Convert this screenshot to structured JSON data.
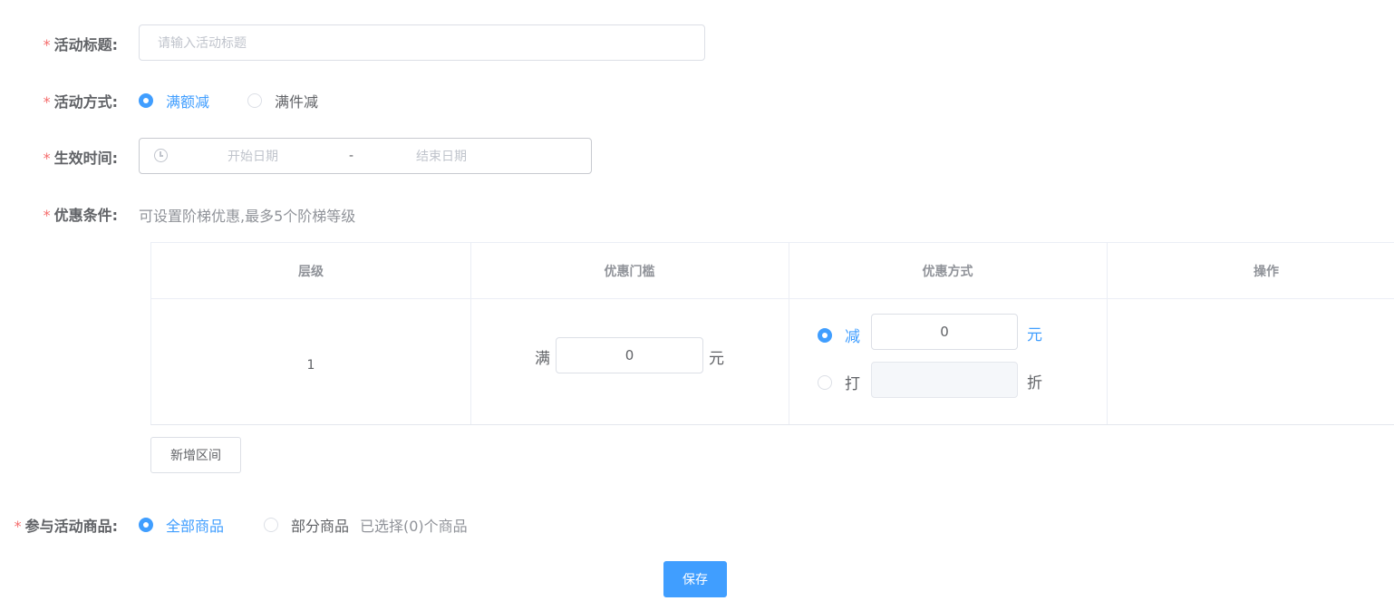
{
  "form": {
    "title": {
      "label": "活动标题:",
      "placeholder": "请输入活动标题"
    },
    "mode": {
      "label": "活动方式:",
      "options": [
        "满额减",
        "满件减"
      ],
      "selected": "满额减"
    },
    "time": {
      "label": "生效时间:",
      "start_placeholder": "开始日期",
      "separator": "-",
      "end_placeholder": "结束日期",
      "icon": "clock-icon"
    },
    "condition": {
      "label": "优惠条件:",
      "hint": "可设置阶梯优惠,最多5个阶梯等级"
    },
    "products": {
      "label": "参与活动商品:",
      "options": [
        "全部商品",
        "部分商品"
      ],
      "selected": "全部商品",
      "selected_count_text": "已选择(0)个商品"
    }
  },
  "table": {
    "headers": [
      "层级",
      "优惠门槛",
      "优惠方式",
      "操作"
    ],
    "rows": [
      {
        "level": "1",
        "threshold_prefix": "满",
        "threshold_value": "0",
        "threshold_unit": "元",
        "discount_options": [
          {
            "label": "减",
            "value": "0",
            "unit": "元",
            "checked": true
          },
          {
            "label": "打",
            "value": "",
            "unit": "折",
            "checked": false
          }
        ]
      }
    ]
  },
  "buttons": {
    "add_range": "新增区间",
    "save": "保存"
  },
  "colors": {
    "primary": "#409eff",
    "required_star": "#f56c6c",
    "border": "#dcdfe6"
  }
}
